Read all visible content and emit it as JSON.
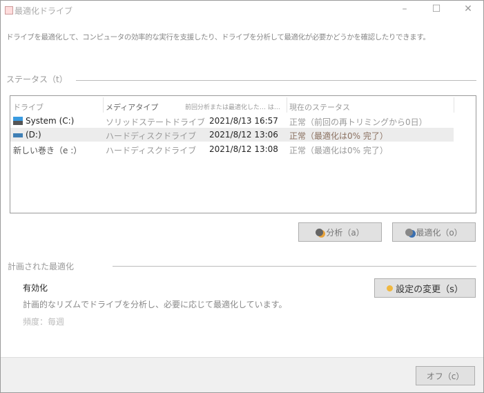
{
  "window": {
    "title": "最適化ドライブ",
    "minimize": "–",
    "maximize": "☐",
    "close": "✕"
  },
  "description": "ドライブを最適化して、コンピュータの効率的な実行を支援したり、ドライブを分析して最適化が必要かどうかを確認したりできます。",
  "status": {
    "label": "ステータス（t）",
    "columns": [
      "ドライブ",
      "メディアタイプ",
      "前回分析または最適化した… は…",
      "現在のステータス"
    ],
    "rows": [
      {
        "drive": "System (C:)",
        "icon": "ssd-drive-icon",
        "media": "ソリッドステートドライブ",
        "last": "2021/8/13 16:57",
        "status": "正常（前回の再トリミングから0日）",
        "selected": false
      },
      {
        "drive": "(D:)",
        "icon": "hdd-drive-icon",
        "media": "ハードディスクドライブ",
        "last": "2021/8/12 13:06",
        "status": "正常（最適化は0% 完了）",
        "selected": true
      },
      {
        "drive": "新しい巻き（e :）",
        "icon": "",
        "media": "ハードディスクドライブ",
        "last": "2021/8/12 13:08",
        "status": "正常（最適化は0% 完了）",
        "selected": false
      }
    ]
  },
  "buttons": {
    "analyze": "分析（a）",
    "optimize": "最適化（o）",
    "change_settings": "設定の変更（s）",
    "off": "オフ（c）"
  },
  "scheduled": {
    "label": "計画された最適化",
    "state": "有効化",
    "description": "計画的なリズムでドライブを分析し、必要に応じて最適化しています。",
    "frequency": "頻度：毎週"
  }
}
